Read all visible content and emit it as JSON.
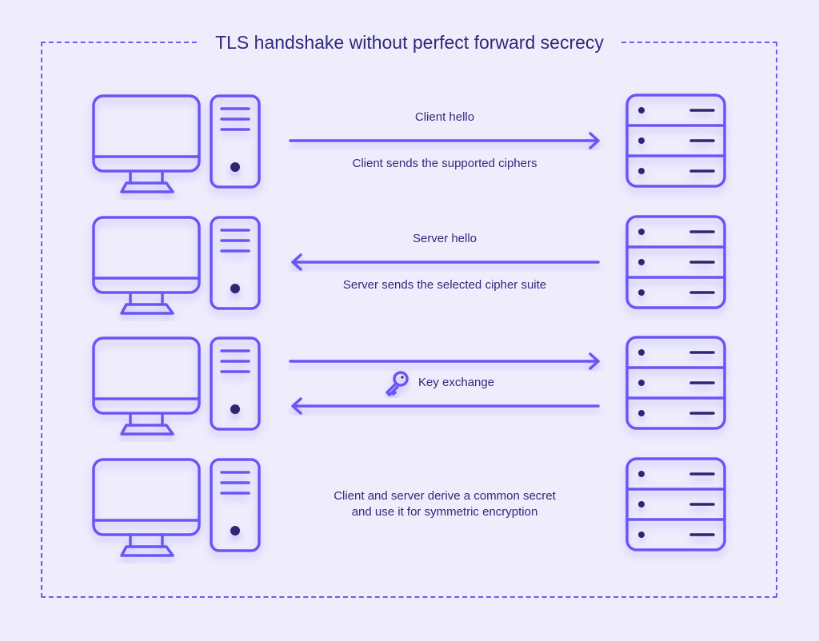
{
  "title": "TLS handshake without perfect forward secrecy",
  "rows": [
    {
      "top_label": "Client hello",
      "bottom_label": "Client sends the supported ciphers",
      "direction": "right"
    },
    {
      "top_label": "Server hello",
      "bottom_label": "Server sends the selected cipher suite",
      "direction": "left"
    },
    {
      "middle_label": "Key exchange",
      "direction": "both",
      "icon": "key-icon"
    },
    {
      "line1": "Client and server derive a common secret",
      "line2": "and use it for symmetric encryption",
      "direction": "none"
    }
  ],
  "colors": {
    "accent": "#6b55f5",
    "text": "#2f2a7a",
    "background": "#efedfc"
  }
}
